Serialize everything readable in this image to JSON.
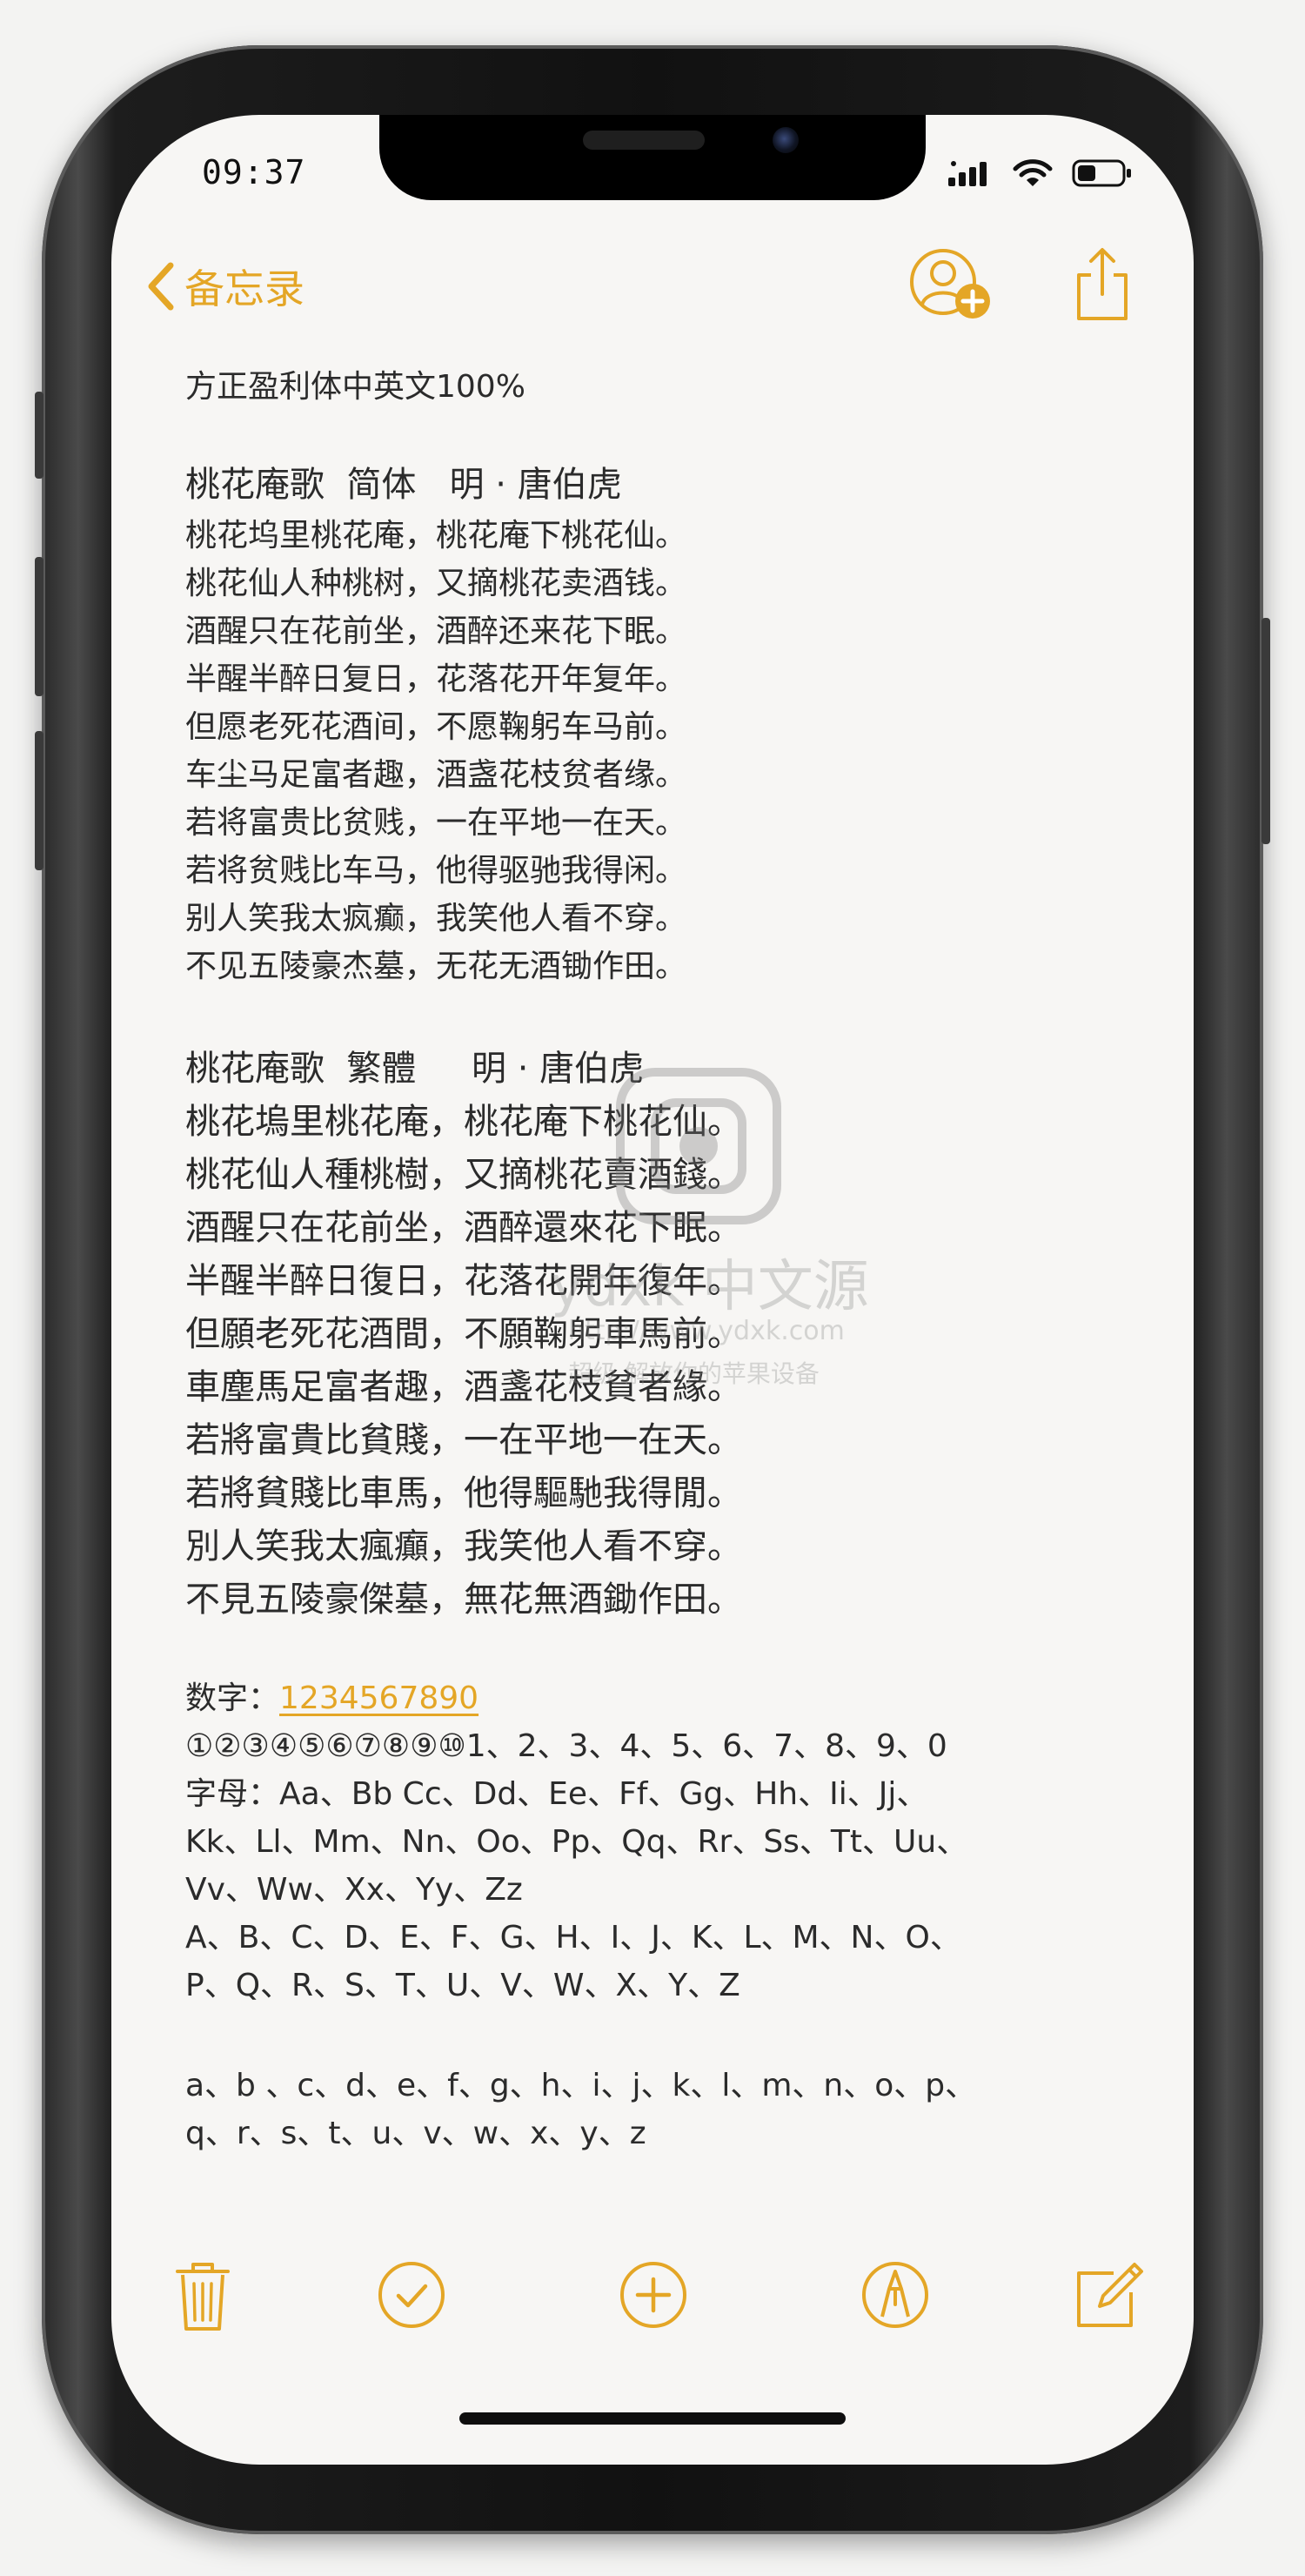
{
  "status_bar": {
    "time": "09:37"
  },
  "nav": {
    "back_label": "备忘录"
  },
  "note": {
    "heading": "方正盈利体中英文100%",
    "poem_simplified": {
      "title": "桃花庵歌  简体   明 · 唐伯虎",
      "lines": [
        "桃花坞里桃花庵，桃花庵下桃花仙。",
        "桃花仙人种桃树，又摘桃花卖酒钱。",
        "酒醒只在花前坐，酒醉还来花下眠。",
        "半醒半醉日复日，花落花开年复年。",
        "但愿老死花酒间，不愿鞠躬车马前。",
        "车尘马足富者趣，酒盏花枝贫者缘。",
        "若将富贵比贫贱，一在平地一在天。",
        "若将贫贱比车马，他得驱驰我得闲。",
        "别人笑我太疯癫，我笑他人看不穿。",
        "不见五陵豪杰墓，无花无酒锄作田。"
      ]
    },
    "poem_traditional": {
      "title": "桃花庵歌  繁體     明 · 唐伯虎",
      "lines": [
        "桃花塢里桃花庵，桃花庵下桃花仙。",
        "桃花仙人種桃樹，又摘桃花賣酒錢。",
        "酒醒只在花前坐，酒醉還來花下眠。",
        "半醒半醉日復日，花落花開年復年。",
        "但願老死花酒間，不願鞠躬車馬前。",
        "車塵馬足富者趣，酒盞花枝貧者緣。",
        "若將富貴比貧賤，一在平地一在天。",
        "若將貧賤比車馬，他得驅馳我得閒。",
        "別人笑我太瘋癲，我笑他人看不穿。",
        "不見五陵豪傑墓，無花無酒鋤作田。"
      ]
    },
    "digits_label": "数字：",
    "digits_value": "1234567890",
    "enumerated": "①②③④⑤⑥⑦⑧⑨⑩1、2、3、4、5、6、7、8、9、0",
    "letters_lines": [
      "字母：Aa、Bb Cc、Dd、Ee、Ff、Gg、Hh、Ii、Jj、",
      "Kk、Ll、Mm、Nn、Oo、Pp、Qq、Rr、Ss、Tt、Uu、",
      "Vv、Ww、Xx、Yy、Zz",
      "A、B、C、D、E、F、G、H、I、J、K、L、M、N、O、",
      "P、Q、R、S、T、U、V、W、X、Y、Z"
    ],
    "lowercase_lines": [
      "a、b 、c、d、e、f、g、h、i、j、k、l、m、n、o、p、",
      "q、r、s、t、u、v、w、x、y、z"
    ]
  },
  "watermark": {
    "brand": "ydxk 中文源",
    "url": "http://www.ydxk.com",
    "tagline": "超级 解放你的苹果设备"
  },
  "icons": {
    "back": "chevron-left-icon",
    "share_people": "add-person-icon",
    "share": "share-icon",
    "trash": "trash-icon",
    "checklist": "checkmark-circle-icon",
    "add": "plus-circle-icon",
    "markup": "pen-circle-icon",
    "compose": "compose-icon"
  },
  "colors": {
    "accent": "#e4a626",
    "text": "#2b2b2b",
    "background": "#f7f6f4"
  }
}
